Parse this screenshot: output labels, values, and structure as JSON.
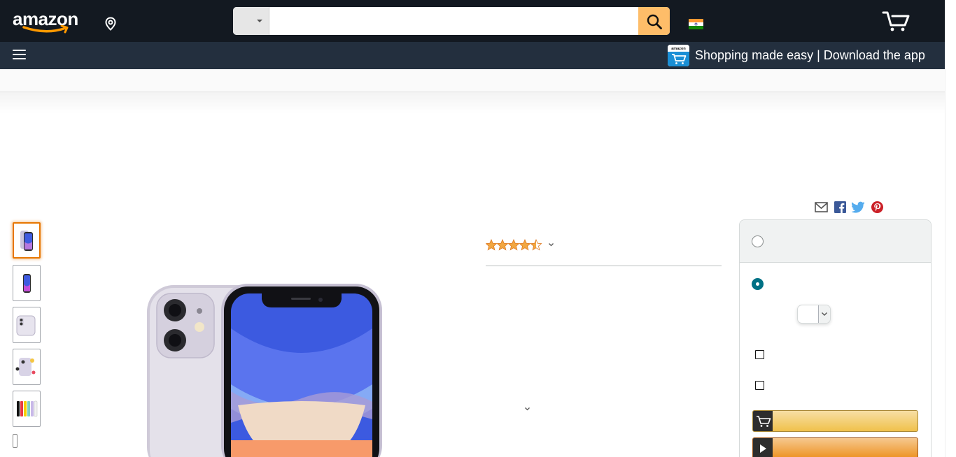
{
  "header": {
    "logo_text": "amazon",
    "search": {
      "placeholder": "",
      "value": "",
      "department": ""
    },
    "flag": "india-flag",
    "cart": "cart-icon"
  },
  "navbar": {
    "menu_icon": "hamburger-menu-icon",
    "promo": "Shopping made easy | Download the app",
    "app_icon_label": "amazon"
  },
  "product": {
    "rating_stars": 4.5,
    "share": [
      "email-icon",
      "facebook-icon",
      "twitter-icon",
      "pinterest-icon"
    ],
    "thumbnails": 5
  },
  "buybox": {
    "quantity": ""
  },
  "colors": {
    "header_bg": "#131921",
    "nav_bg": "#232f3e",
    "search_button": "#febd69",
    "star": "#f2a742",
    "radio_selected": "#007185",
    "add_to_cart": "#f0c14b",
    "buy_now": "#ed9220"
  }
}
